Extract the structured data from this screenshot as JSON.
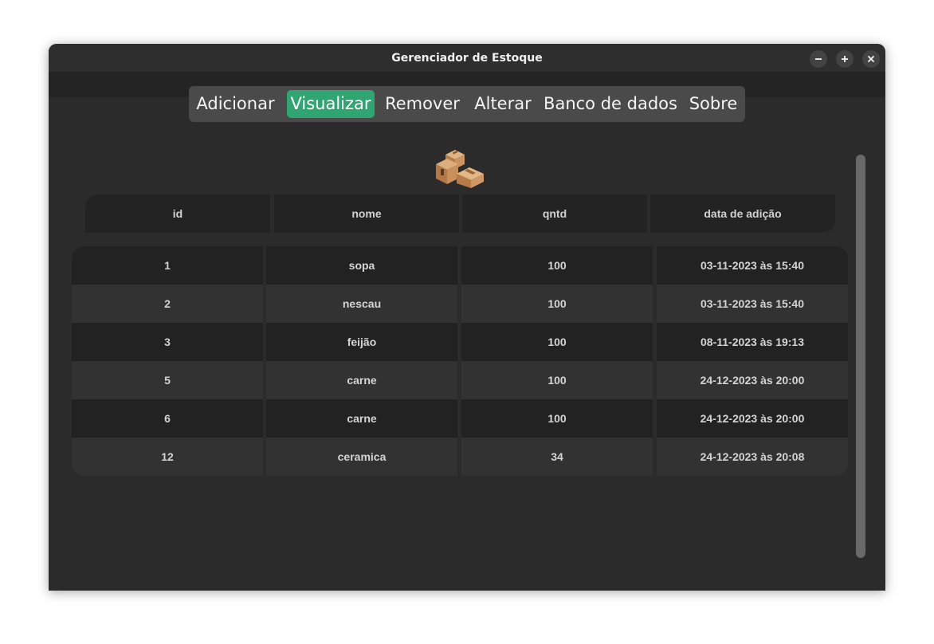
{
  "window": {
    "title": "Gerenciador de Estoque"
  },
  "nav": {
    "tabs": [
      {
        "label": "Adicionar"
      },
      {
        "label": "Visualizar",
        "active": true
      },
      {
        "label": "Remover"
      },
      {
        "label": "Alterar"
      },
      {
        "label": "Banco de dados"
      },
      {
        "label": "Sobre"
      }
    ],
    "active_color": "#2fa572"
  },
  "header_icon": "package-boxes-icon",
  "table": {
    "columns": [
      "id",
      "nome",
      "qntd",
      "data de adição"
    ],
    "rows": [
      {
        "id": "1",
        "nome": "sopa",
        "qntd": "100",
        "data": "03-11-2023 às 15:40"
      },
      {
        "id": "2",
        "nome": "nescau",
        "qntd": "100",
        "data": "03-11-2023 às 15:40"
      },
      {
        "id": "3",
        "nome": "feijão",
        "qntd": "100",
        "data": "08-11-2023 às 19:13"
      },
      {
        "id": "5",
        "nome": "carne",
        "qntd": "100",
        "data": "24-12-2023 às 20:00"
      },
      {
        "id": "6",
        "nome": "carne",
        "qntd": "100",
        "data": "24-12-2023 às 20:00"
      },
      {
        "id": "12",
        "nome": "ceramica",
        "qntd": "34",
        "data": "24-12-2023 às 20:08"
      }
    ]
  }
}
